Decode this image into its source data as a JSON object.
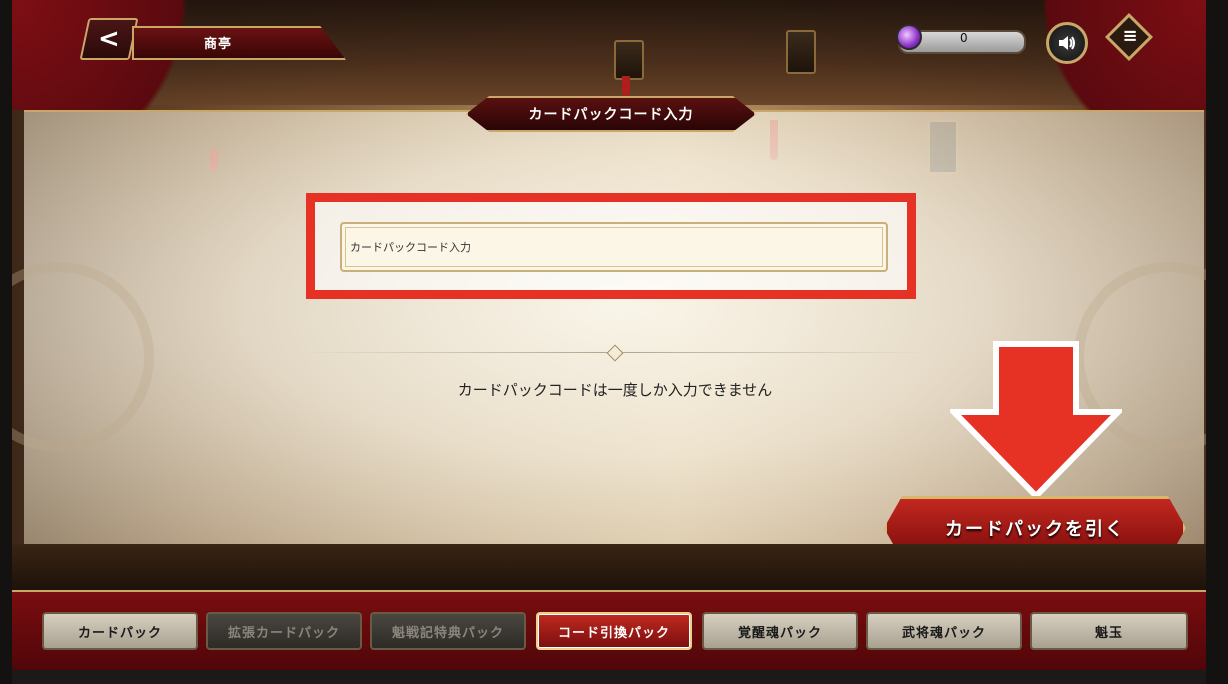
{
  "header": {
    "back_label": "<",
    "location_title": "商亭",
    "currency_value": "0",
    "sound_icon": "speaker-icon",
    "menu_icon": "hamburger-icon"
  },
  "panel": {
    "title": "カードパックコード入力",
    "input_placeholder": "カードパックコード入力",
    "input_value": "",
    "notice": "カードパックコードは一度しか入力できません",
    "draw_button_label": "カードパックを引く",
    "highlight_color": "#e53225"
  },
  "tabs": [
    {
      "label": "カードパック",
      "state": "normal"
    },
    {
      "label": "拡張カードパック",
      "state": "disabled"
    },
    {
      "label": "魁戦記特典パック",
      "state": "disabled"
    },
    {
      "label": "コード引換パック",
      "state": "active"
    },
    {
      "label": "覚醒魂パック",
      "state": "normal"
    },
    {
      "label": "武将魂パック",
      "state": "normal"
    },
    {
      "label": "魁玉",
      "state": "normal"
    }
  ],
  "colors": {
    "accent_red": "#c0281f",
    "gold_trim": "#c9a768",
    "annotation_red": "#e53225"
  }
}
